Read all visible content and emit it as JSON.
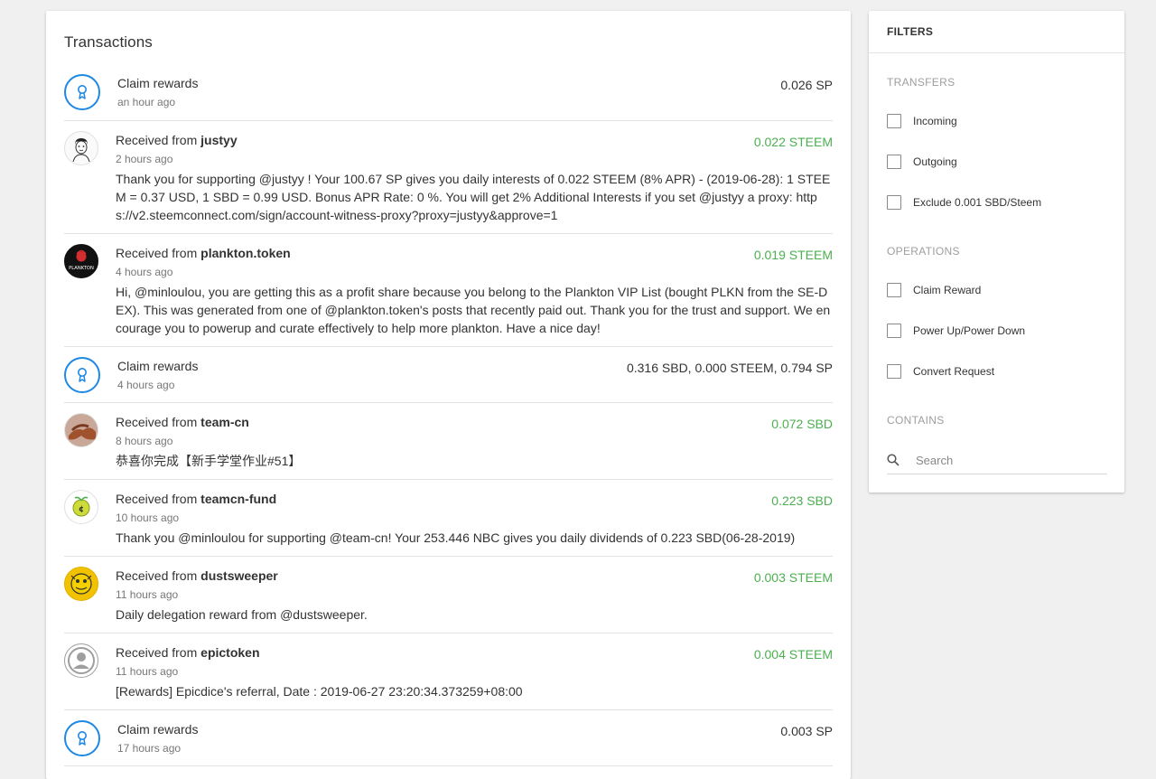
{
  "transactions": {
    "title": "Transactions",
    "items": [
      {
        "type": "claim",
        "title": "Claim rewards",
        "time": "an hour ago",
        "amount": "0.026 SP"
      },
      {
        "type": "received",
        "prefix": "Received from ",
        "from": "justyy",
        "time": "2 hours ago",
        "amount": "0.022 STEEM",
        "memo": "Thank you for supporting @justyy ! Your 100.67 SP gives you daily interests of 0.022 STEEM (8% APR) - (2019-06-28): 1 STEEM = 0.37 USD, 1 SBD = 0.99 USD. Bonus APR Rate: 0 %. You will get 2% Additional Interests if you set @justyy a proxy: https://v2.steemconnect.com/sign/account-witness-proxy?proxy=justyy&approve=1"
      },
      {
        "type": "received",
        "prefix": "Received from ",
        "from": "plankton.token",
        "time": "4 hours ago",
        "amount": "0.019 STEEM",
        "memo": "Hi, @minloulou, you are getting this as a profit share because you belong to the Plankton VIP List (bought PLKN from the SE-DEX). This was generated from one of @plankton.token's posts that recently paid out. Thank you for the trust and support. We encourage you to powerup and curate effectively to help more plankton. Have a nice day!",
        "avatar_text": "PLANKTON"
      },
      {
        "type": "claim",
        "title": "Claim rewards",
        "time": "4 hours ago",
        "amount": "0.316 SBD, 0.000 STEEM, 0.794 SP"
      },
      {
        "type": "received",
        "prefix": "Received from ",
        "from": "team-cn",
        "time": "8 hours ago",
        "amount": "0.072 SBD",
        "memo": "恭喜你完成【新手学堂作业#51】"
      },
      {
        "type": "received",
        "prefix": "Received from ",
        "from": "teamcn-fund",
        "time": "10 hours ago",
        "amount": "0.223 SBD",
        "memo": "Thank you @minloulou for supporting @team-cn! Your 253.446 NBC gives you daily dividends of 0.223 SBD(06-28-2019)"
      },
      {
        "type": "received",
        "prefix": "Received from ",
        "from": "dustsweeper",
        "time": "11 hours ago",
        "amount": "0.003 STEEM",
        "memo": "Daily delegation reward from @dustsweeper."
      },
      {
        "type": "received",
        "prefix": "Received from ",
        "from": "epictoken",
        "time": "11 hours ago",
        "amount": "0.004 STEEM",
        "memo": "[Rewards] Epicdice's referral, Date : 2019-06-27 23:20:34.373259+08:00"
      },
      {
        "type": "claim",
        "title": "Claim rewards",
        "time": "17 hours ago",
        "amount": "0.003 SP"
      }
    ]
  },
  "filters": {
    "title": "FILTERS",
    "transfers_label": "TRANSFERS",
    "incoming": "Incoming",
    "outgoing": "Outgoing",
    "exclude": "Exclude 0.001 SBD/Steem",
    "operations_label": "OPERATIONS",
    "claim_reward": "Claim Reward",
    "power": "Power Up/Power Down",
    "convert": "Convert Request",
    "contains_label": "CONTAINS",
    "search_placeholder": "Search"
  },
  "colors": {
    "accent_blue": "#1e88e5",
    "amount_green": "#4caf50"
  }
}
